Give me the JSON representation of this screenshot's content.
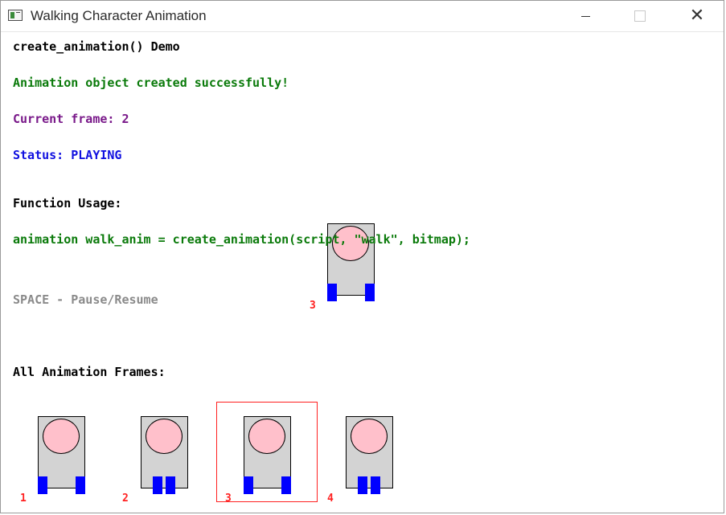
{
  "window": {
    "title": "Walking Character Animation",
    "controls": {
      "minimize": "minimize",
      "maximize": "maximize",
      "close": "✕"
    }
  },
  "content": {
    "heading": "create_animation() Demo",
    "success": "Animation object created successfully!",
    "current_frame": "Current frame: 2",
    "status": "Status: PLAYING",
    "usage_heading": "Function Usage:",
    "usage_code": "animation walk_anim = create_animation(script, \"walk\", bitmap);",
    "controls_hint": "SPACE - Pause/Resume",
    "frames_heading": "All Animation Frames:"
  },
  "preview": {
    "frame_label": "3"
  },
  "frames": [
    {
      "label": "1",
      "selected": false
    },
    {
      "label": "2",
      "selected": false
    },
    {
      "label": "3",
      "selected": true
    },
    {
      "label": "4",
      "selected": false
    }
  ],
  "colors": {
    "success": "#0a7a0a",
    "frame_text": "#7a1a8a",
    "status": "#1010e0",
    "hint": "#8a8a8a",
    "highlight": "#ff2020",
    "sprite_body": "#d3d3d3",
    "sprite_head": "#ffc0cb",
    "sprite_feet": "#0000ff"
  },
  "icons": {
    "app": "app-window-icon",
    "minimize": "minimize-icon",
    "maximize": "maximize-icon",
    "close": "close-icon"
  }
}
